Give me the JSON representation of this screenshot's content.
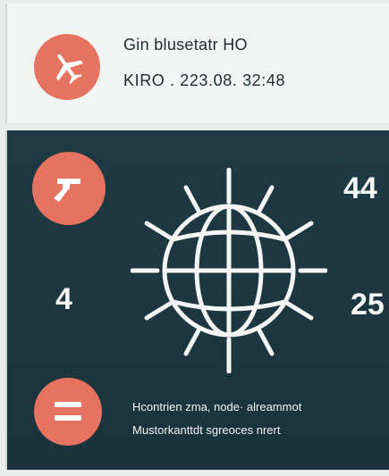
{
  "header": {
    "line1": "Gin blusetatr HO",
    "line2": "KIRO . 223.08. 32:48"
  },
  "panel": {
    "stat_left": "4",
    "stat_right_top": "44",
    "stat_right_mid": "25",
    "text_line1": "Hcontrien zma, node· alreammot",
    "text_line2": "Mustorkanttdt sgreoces nrert"
  },
  "icons": {
    "header_icon": "airplane-icon",
    "panel_icon_top": "wrench-icon",
    "panel_icon_center": "globe-icon",
    "panel_icon_bottom": "menu-icon"
  },
  "colors": {
    "accent": "#e6735f",
    "panel_bg": "#1f3a44",
    "card_bg": "#f2f4f3"
  }
}
